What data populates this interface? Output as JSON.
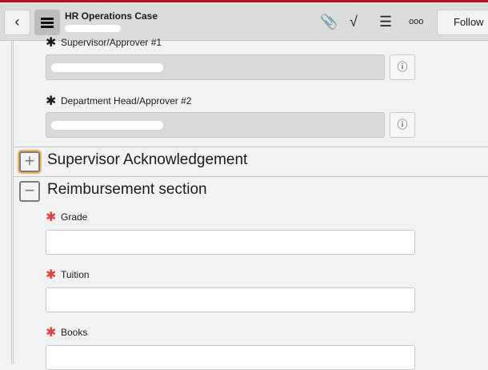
{
  "header": {
    "title": "HR Operations Case",
    "follow_label": "Follow",
    "back_icon": "chevron-left-icon",
    "menu_icon": "hamburger-icon",
    "icons": [
      "paperclip-icon",
      "activity-icon",
      "sliders-icon",
      "more-icon"
    ]
  },
  "fields": {
    "supervisor_label": "Supervisor/Approver #1",
    "dept_head_label": "Department Head/Approver #2"
  },
  "sections": {
    "supervisor_ack": "Supervisor Acknowledgement",
    "reimbursement": "Reimbursement section"
  },
  "reimbursement_fields": [
    {
      "label": "Grade",
      "value": ""
    },
    {
      "label": "Tuition",
      "value": ""
    },
    {
      "label": "Books",
      "value": ""
    }
  ],
  "colors": {
    "brand": "#b5121b",
    "required": "#e2403f",
    "focus": "#f5b454"
  }
}
